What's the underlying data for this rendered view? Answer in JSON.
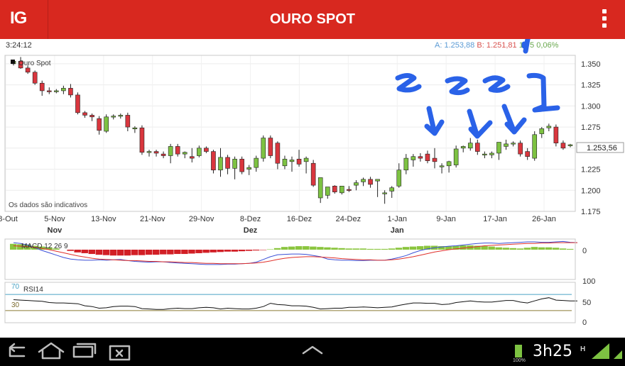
{
  "app": {
    "logo": "IG",
    "title": "OURO SPOT",
    "menu_icon": "overflow-menu-icon"
  },
  "quote": {
    "time": "3:24:12",
    "ask_label": "A:",
    "ask": "1.253,88",
    "bid_label": "B:",
    "bid": "1.251,81",
    "change": "1,75",
    "change_pct": "0,06%",
    "ask_color": "#5b9bd5",
    "bid_color": "#d9534f",
    "change_color": "#6aa84f"
  },
  "chart": {
    "legend": "Ouro Spot",
    "disclaimer": "Os dados são indicativos",
    "last_price": "1.253,56"
  },
  "macd": {
    "label": "MACD 12 26 9",
    "zero_label": "0"
  },
  "rsi": {
    "label": "RSI14",
    "upper": "70",
    "lower": "30",
    "axis": [
      "100",
      "50",
      "0"
    ]
  },
  "statusbar": {
    "time": "3h25",
    "battery": "100%",
    "network": "H"
  },
  "chart_data": {
    "type": "candlestick",
    "y_ticks": [
      "1.350",
      "1.325",
      "1.300",
      "1.275",
      "1.250",
      "1.225",
      "1.200",
      "1.175"
    ],
    "ylim": [
      1175,
      1360
    ],
    "x_ticks": [
      "28-Out",
      "5-Nov",
      "13-Nov",
      "21-Nov",
      "29-Nov",
      "8-Dez",
      "16-Dez",
      "24-Dez",
      "1-Jan",
      "9-Jan",
      "17-Jan",
      "26-Jan"
    ],
    "months": [
      "Nov",
      "Dez",
      "Jan"
    ],
    "candles": [
      [
        1350,
        1355,
        1348,
        1353
      ],
      [
        1353,
        1358,
        1344,
        1345
      ],
      [
        1345,
        1348,
        1338,
        1340
      ],
      [
        1340,
        1342,
        1325,
        1327
      ],
      [
        1327,
        1330,
        1312,
        1318
      ],
      [
        1318,
        1322,
        1314,
        1317
      ],
      [
        1317,
        1320,
        1315,
        1318
      ],
      [
        1318,
        1324,
        1314,
        1321
      ],
      [
        1321,
        1326,
        1310,
        1313
      ],
      [
        1313,
        1316,
        1290,
        1292
      ],
      [
        1292,
        1294,
        1286,
        1289
      ],
      [
        1289,
        1291,
        1282,
        1287
      ],
      [
        1285,
        1288,
        1266,
        1271
      ],
      [
        1270,
        1290,
        1268,
        1287
      ],
      [
        1287,
        1290,
        1284,
        1288
      ],
      [
        1288,
        1291,
        1285,
        1289
      ],
      [
        1289,
        1292,
        1270,
        1275
      ],
      [
        1273,
        1276,
        1268,
        1274
      ],
      [
        1274,
        1277,
        1242,
        1245
      ],
      [
        1245,
        1248,
        1240,
        1246
      ],
      [
        1246,
        1248,
        1240,
        1244
      ],
      [
        1243,
        1246,
        1238,
        1241
      ],
      [
        1241,
        1255,
        1232,
        1252
      ],
      [
        1252,
        1255,
        1240,
        1243
      ],
      [
        1243,
        1246,
        1238,
        1245
      ],
      [
        1240,
        1250,
        1233,
        1238
      ],
      [
        1241,
        1253,
        1239,
        1250
      ],
      [
        1250,
        1252,
        1244,
        1246
      ],
      [
        1246,
        1248,
        1220,
        1224
      ],
      [
        1224,
        1250,
        1216,
        1239
      ],
      [
        1239,
        1242,
        1219,
        1226
      ],
      [
        1226,
        1240,
        1213,
        1237
      ],
      [
        1237,
        1240,
        1219,
        1222
      ],
      [
        1225,
        1230,
        1218,
        1227
      ],
      [
        1227,
        1241,
        1222,
        1238
      ],
      [
        1238,
        1265,
        1234,
        1262
      ],
      [
        1262,
        1265,
        1238,
        1241
      ],
      [
        1256,
        1258,
        1225,
        1232
      ],
      [
        1229,
        1241,
        1225,
        1237
      ],
      [
        1234,
        1240,
        1222,
        1236
      ],
      [
        1237,
        1248,
        1228,
        1231
      ],
      [
        1234,
        1240,
        1220,
        1238
      ],
      [
        1232,
        1236,
        1204,
        1206
      ],
      [
        1191,
        1210,
        1185,
        1215
      ],
      [
        1194,
        1203,
        1190,
        1204
      ],
      [
        1205,
        1206,
        1196,
        1198
      ],
      [
        1197,
        1205,
        1195,
        1205
      ],
      [
        1201,
        1205,
        1198,
        1200
      ],
      [
        1206,
        1212,
        1200,
        1209
      ],
      [
        1210,
        1215,
        1205,
        1213
      ],
      [
        1213,
        1216,
        1203,
        1207
      ],
      [
        1211,
        1213,
        1192,
        1213
      ],
      [
        1196,
        1200,
        1184,
        1197
      ],
      [
        1199,
        1205,
        1191,
        1203
      ],
      [
        1205,
        1232,
        1203,
        1224
      ],
      [
        1224,
        1243,
        1219,
        1238
      ],
      [
        1236,
        1243,
        1228,
        1240
      ],
      [
        1240,
        1244,
        1234,
        1238
      ],
      [
        1243,
        1247,
        1232,
        1235
      ],
      [
        1238,
        1250,
        1226,
        1234
      ],
      [
        1228,
        1232,
        1220,
        1229
      ],
      [
        1229,
        1235,
        1221,
        1234
      ],
      [
        1230,
        1253,
        1227,
        1249
      ],
      [
        1250,
        1253,
        1245,
        1252
      ],
      [
        1250,
        1262,
        1247,
        1256
      ],
      [
        1256,
        1260,
        1242,
        1246
      ],
      [
        1242,
        1246,
        1238,
        1243
      ],
      [
        1242,
        1246,
        1238,
        1244
      ],
      [
        1244,
        1251,
        1236,
        1257
      ],
      [
        1252,
        1260,
        1248,
        1255
      ],
      [
        1255,
        1258,
        1252,
        1256
      ],
      [
        1256,
        1259,
        1240,
        1243
      ],
      [
        1246,
        1250,
        1236,
        1240
      ],
      [
        1238,
        1270,
        1235,
        1266
      ],
      [
        1267,
        1275,
        1262,
        1273
      ],
      [
        1274,
        1279,
        1270,
        1276
      ],
      [
        1275,
        1278,
        1252,
        1256
      ],
      [
        1256,
        1259,
        1248,
        1250
      ],
      [
        1253,
        1255,
        1251,
        1254
      ]
    ],
    "macd_hist": [
      15,
      14,
      13,
      10,
      8,
      6,
      3,
      0,
      -3,
      -7,
      -9,
      -11,
      -13,
      -14,
      -15,
      -15,
      -15,
      -14,
      -14,
      -13,
      -13,
      -12,
      -12,
      -11,
      -11,
      -10,
      -9,
      -8,
      -7,
      -6,
      -5,
      -5,
      -4,
      -3,
      -2,
      -1,
      1,
      4,
      7,
      8,
      9,
      9,
      8,
      7,
      6,
      5,
      4,
      3,
      3,
      3,
      2,
      2,
      2,
      3,
      5,
      7,
      8,
      9,
      10,
      10,
      9,
      9,
      10,
      11,
      11,
      10,
      9,
      8,
      6,
      5,
      4,
      3,
      5,
      7,
      6,
      6,
      5,
      3,
      2
    ],
    "macd_line": [
      18,
      16,
      12,
      5,
      -2,
      -8,
      -14,
      -20,
      -24,
      -26,
      -27,
      -27,
      -26,
      -27,
      -26,
      -25,
      -28,
      -30,
      -31,
      -32,
      -31,
      -31,
      -33,
      -34,
      -35,
      -36,
      -37,
      -38,
      -38,
      -38,
      -37,
      -37,
      -36,
      -35,
      -32,
      -25,
      -18,
      -13,
      -12,
      -11,
      -11,
      -12,
      -15,
      -18,
      -24,
      -26,
      -27,
      -27,
      -28,
      -28,
      -27,
      -27,
      -27,
      -24,
      -20,
      -15,
      -8,
      -2,
      2,
      5,
      7,
      9,
      10,
      12,
      14,
      16,
      17,
      17,
      16,
      17,
      18,
      19,
      20,
      20,
      19,
      19,
      20,
      21,
      19,
      18
    ],
    "signal_line": [
      10,
      9,
      8,
      6,
      3,
      0,
      -4,
      -8,
      -12,
      -16,
      -19,
      -22,
      -24,
      -25,
      -26,
      -27,
      -28,
      -28,
      -29,
      -30,
      -30,
      -31,
      -31,
      -32,
      -33,
      -33,
      -34,
      -35,
      -35,
      -36,
      -36,
      -36,
      -36,
      -35,
      -34,
      -32,
      -29,
      -25,
      -22,
      -20,
      -19,
      -18,
      -18,
      -19,
      -20,
      -21,
      -23,
      -24,
      -25,
      -26,
      -26,
      -27,
      -27,
      -26,
      -24,
      -21,
      -18,
      -14,
      -10,
      -6,
      -3,
      0,
      2,
      4,
      6,
      8,
      10,
      11,
      12,
      13,
      14,
      15,
      16,
      16,
      17,
      17,
      18,
      18,
      18,
      18
    ],
    "rsi": [
      57,
      56,
      55,
      54,
      53,
      50,
      49,
      49,
      48,
      47,
      42,
      40,
      36,
      37,
      40,
      41,
      41,
      40,
      35,
      34,
      33,
      33,
      35,
      36,
      35,
      35,
      37,
      38,
      37,
      34,
      36,
      35,
      34,
      34,
      36,
      40,
      48,
      45,
      44,
      42,
      42,
      41,
      38,
      34,
      35,
      36,
      36,
      38,
      38,
      39,
      38,
      37,
      38,
      39,
      43,
      46,
      49,
      49,
      48,
      48,
      45,
      46,
      50,
      52,
      54,
      52,
      51,
      51,
      53,
      55,
      55,
      51,
      49,
      54,
      59,
      62,
      56,
      55,
      54,
      54
    ]
  }
}
